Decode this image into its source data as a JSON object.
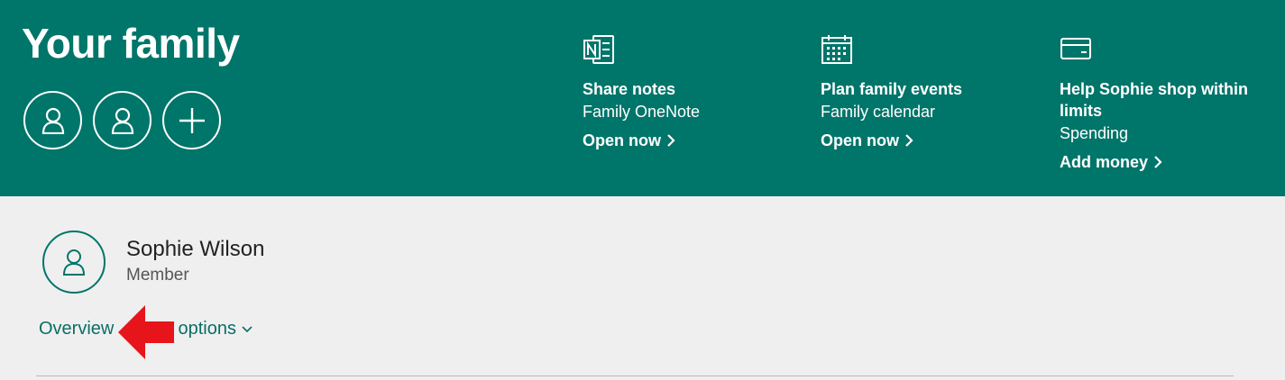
{
  "header": {
    "title": "Your family",
    "member_circles": [
      {
        "icon": "person-icon"
      },
      {
        "icon": "person-icon"
      },
      {
        "icon": "plus-icon"
      }
    ]
  },
  "features": [
    {
      "icon": "onenote-icon",
      "heading": "Share notes",
      "subtitle": "Family OneNote",
      "link": "Open now"
    },
    {
      "icon": "calendar-icon",
      "heading": "Plan family events",
      "subtitle": "Family calendar",
      "link": "Open now"
    },
    {
      "icon": "wallet-icon",
      "heading": "Help Sophie shop within limits",
      "subtitle": "Spending",
      "link": "Add money"
    }
  ],
  "member": {
    "name": "Sophie Wilson",
    "role": "Member",
    "avatar_icon": "person-icon"
  },
  "tabs": {
    "overview": "Overview",
    "more_options": "More options"
  },
  "annotation": {
    "icon": "red-arrow-icon",
    "color": "#e8141b"
  },
  "colors": {
    "banner": "#00756a",
    "background": "#efefef",
    "link": "#0a6e66"
  }
}
